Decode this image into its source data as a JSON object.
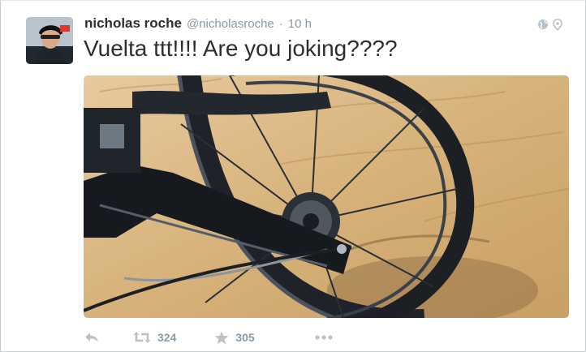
{
  "tweet": {
    "fullname": "nicholas roche",
    "username": "@nicholasroche",
    "separator": "·",
    "time": "10 h",
    "text": "Vuelta ttt!!!! Are you joking????",
    "media": {
      "icon": "photo-bike-wheel-in-sand"
    },
    "actions": {
      "reply_icon": "reply-icon",
      "retweet_icon": "retweet-icon",
      "retweet_count": "324",
      "favorite_icon": "star-icon",
      "favorite_count": "305",
      "more_icon": "more-icon"
    }
  },
  "colors": {
    "meta": "#8899a6",
    "text": "#292f33",
    "sand": "#d9b77a"
  }
}
